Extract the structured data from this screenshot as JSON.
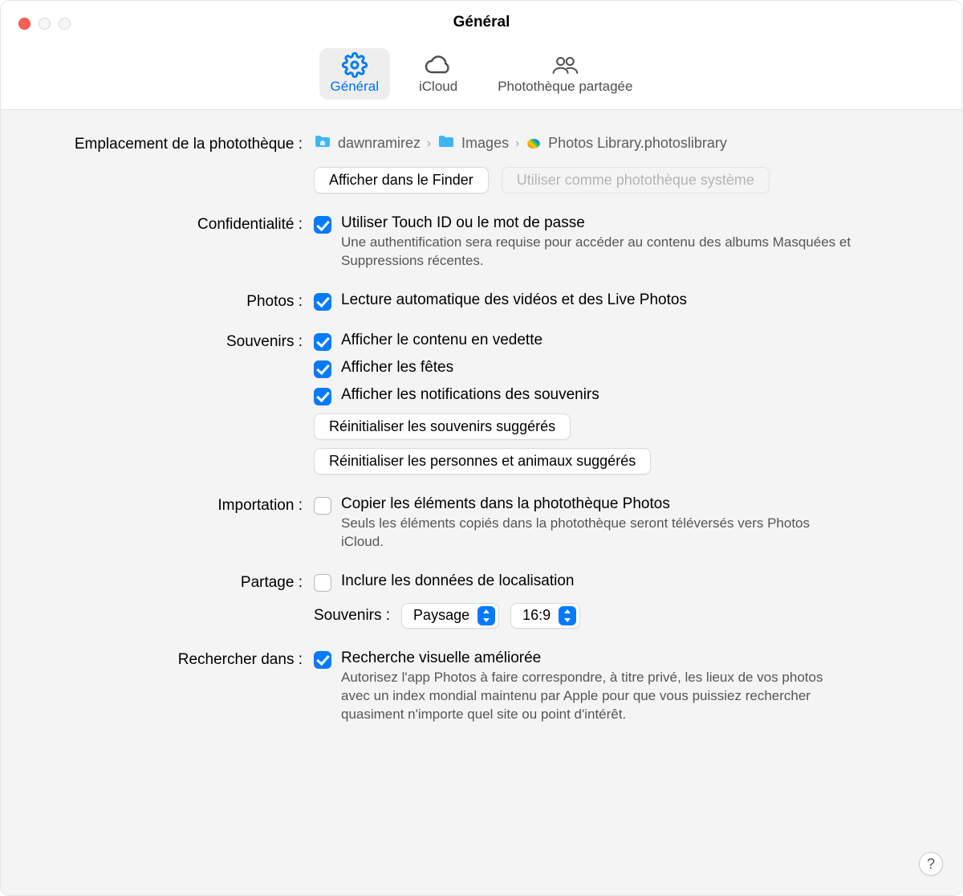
{
  "window": {
    "title": "Général"
  },
  "tabs": {
    "general": "Général",
    "icloud": "iCloud",
    "shared": "Photothèque partagée"
  },
  "library": {
    "label": "Emplacement de la photothèque :",
    "path": {
      "user": "dawnramirez",
      "folder": "Images",
      "file": "Photos Library.photoslibrary"
    },
    "show_in_finder": "Afficher dans le Finder",
    "use_as_system": "Utiliser comme photothèque système"
  },
  "privacy": {
    "label": "Confidentialité :",
    "checkbox_label": "Utiliser Touch ID ou le mot de passe",
    "desc": "Une authentification sera requise pour accéder au contenu des albums Masquées et Suppressions récentes."
  },
  "photos": {
    "label": "Photos :",
    "autoplay_label": "Lecture automatique des vidéos et des Live Photos"
  },
  "memories": {
    "label": "Souvenirs :",
    "show_featured": "Afficher le contenu en vedette",
    "show_holidays": "Afficher les fêtes",
    "show_notifications": "Afficher les notifications des souvenirs",
    "reset_suggested": "Réinitialiser les souvenirs suggérés",
    "reset_people": "Réinitialiser les personnes et animaux suggérés"
  },
  "import": {
    "label": "Importation :",
    "copy_label": "Copier les éléments dans la photothèque Photos",
    "desc": "Seuls les éléments copiés dans la photothèque seront téléversés vers Photos iCloud."
  },
  "sharing": {
    "label": "Partage :",
    "include_location": "Inclure les données de localisation",
    "memories_sublabel": "Souvenirs :",
    "orientation": "Paysage",
    "aspect": "16:9"
  },
  "search": {
    "label": "Rechercher dans :",
    "title": "Recherche visuelle améliorée",
    "desc": "Autorisez l'app Photos à faire correspondre, à titre privé, les lieux de vos photos avec un index mondial maintenu par Apple pour que vous puissiez rechercher quasiment n'importe quel site ou point d'intérêt."
  },
  "help_symbol": "?"
}
